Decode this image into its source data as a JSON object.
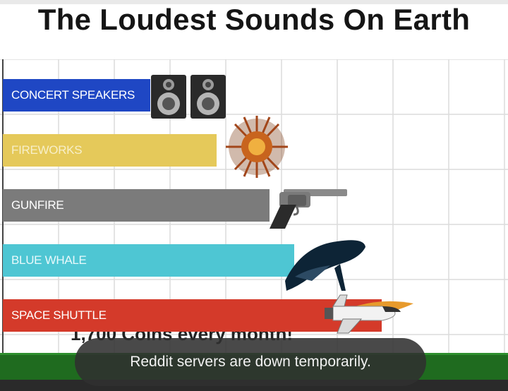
{
  "title": "The Loudest Sounds On Earth",
  "behind_caption": "1,700 Coins every month!",
  "toast": {
    "message": "Reddit servers are down temporarily."
  },
  "chart_data": {
    "type": "bar",
    "orientation": "horizontal",
    "title": "The Loudest Sounds On Earth",
    "categories": [
      "CONCERT SPEAKERS",
      "FIREWORKS",
      "GUNFIRE",
      "BLUE WHALE",
      "SPACE SHUTTLE"
    ],
    "values": [
      210,
      305,
      380,
      415,
      540
    ],
    "bar_colors": [
      "#1f47c4",
      "#e5c95a",
      "#7b7b7b",
      "#4ec6d3",
      "#d43a2a"
    ],
    "label_colors": [
      "#ffffff",
      "#f7efc9",
      "#ffffff",
      "#e8f9fb",
      "#ffffff"
    ],
    "icons": [
      "speakers-icon",
      "firework-burst-icon",
      "revolver-icon",
      "whale-icon",
      "space-shuttle-icon"
    ],
    "xlim": [
      0,
      720
    ],
    "grid": true
  }
}
